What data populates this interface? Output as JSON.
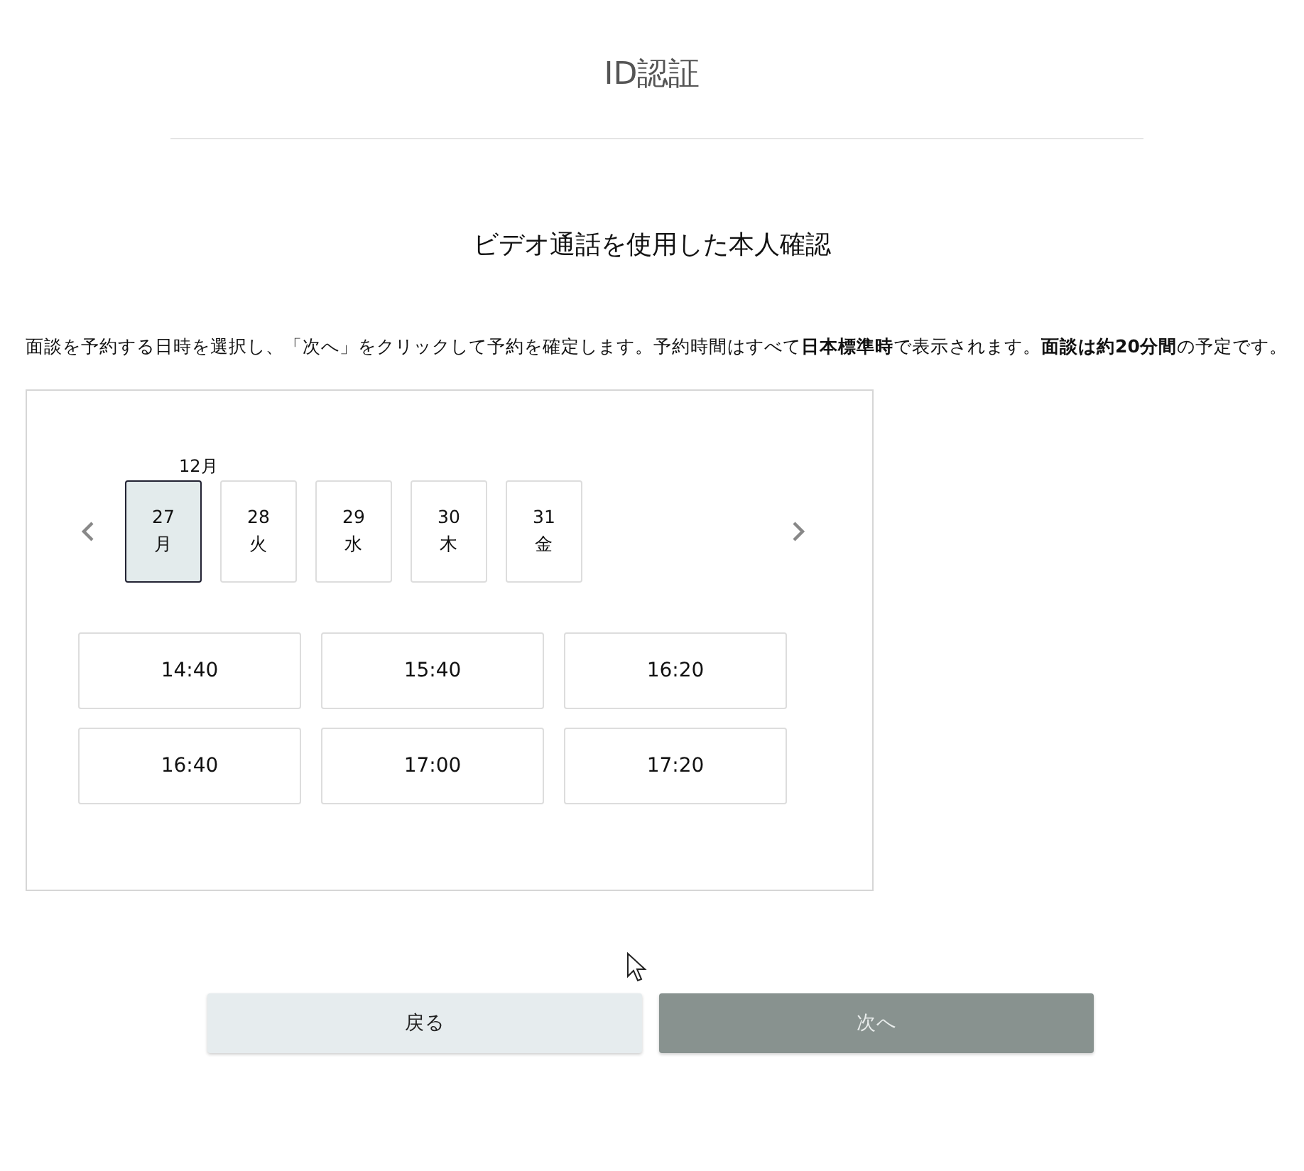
{
  "header": {
    "title": "ID認証"
  },
  "heading": "ビデオ通話を使用した本人確認",
  "instructions": "面談を予約する日時を選択し、「次へ」をクリックして予約を確定します。予約時間はすべて**日本標準時**で表示されます。**面談は約20分間**の予定です。",
  "calendar": {
    "month": "12月",
    "days": [
      {
        "date": "27",
        "weekday": "月",
        "selected": true
      },
      {
        "date": "28",
        "weekday": "火",
        "selected": false
      },
      {
        "date": "29",
        "weekday": "水",
        "selected": false
      },
      {
        "date": "30",
        "weekday": "木",
        "selected": false
      },
      {
        "date": "31",
        "weekday": "金",
        "selected": false
      }
    ],
    "times": [
      {
        "label": "14:40",
        "selected": false
      },
      {
        "label": "15:40",
        "selected": false
      },
      {
        "label": "16:20",
        "selected": false
      },
      {
        "label": "16:40",
        "selected": false
      },
      {
        "label": "17:00",
        "selected": false
      },
      {
        "label": "17:20",
        "selected": false
      }
    ]
  },
  "buttons": [
    {
      "label": "戻る",
      "disabled": false
    },
    {
      "label": "次へ",
      "disabled": true
    }
  ]
}
